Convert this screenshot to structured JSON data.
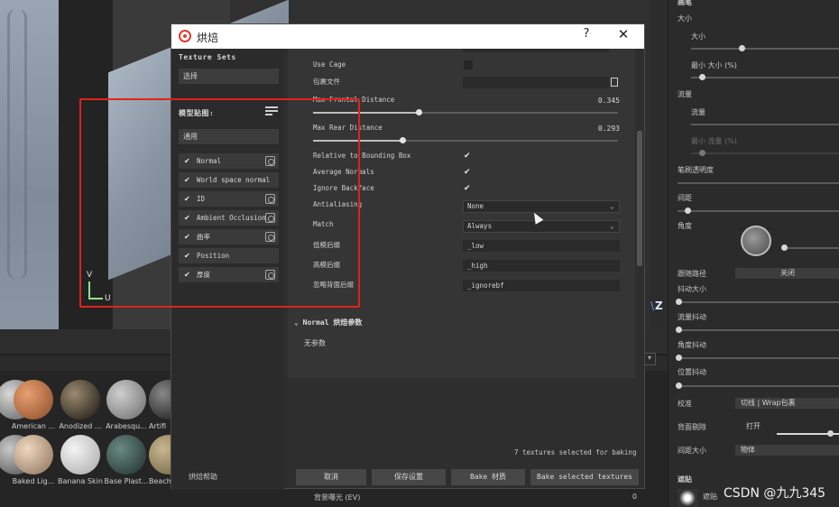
{
  "dialog": {
    "title": "烘焙",
    "help_glyph": "?",
    "close_glyph": "✕",
    "texture_sets_label": "Texture Sets",
    "texture_sets_value": "选择",
    "model_maps_label": "模型贴图:",
    "model_maps_value": "通用",
    "maps": [
      {
        "name": "Normal",
        "checked": true
      },
      {
        "name": "World space normal",
        "checked": true
      },
      {
        "name": "ID",
        "checked": true
      },
      {
        "name": "Ambient Occlusion",
        "checked": true
      },
      {
        "name": "曲率",
        "checked": true
      },
      {
        "name": "Position",
        "checked": true
      },
      {
        "name": "厚度",
        "checked": true
      }
    ],
    "settings": {
      "use_cage": "Use Cage",
      "cage_file": "包裹文件",
      "max_frontal_distance": "Max Frontal Distance",
      "max_frontal_value": "0.345",
      "max_frontal_fraction": 0.345,
      "max_rear_distance": "Max Rear Distance",
      "max_rear_value": "0.293",
      "max_rear_fraction": 0.293,
      "relative_bbox": "Relative to Bounding Box",
      "average_normals": "Average Normals",
      "ignore_backface": "Ignore Backface",
      "antialiasing": "Antialiasing",
      "antialiasing_value": "None",
      "match": "Match",
      "match_value": "Always",
      "low_suffix_label": "低模后缀",
      "low_suffix_value": "_low",
      "high_suffix_label": "高模后缀",
      "high_suffix_value": "_high",
      "ignore_backface_suffix_label": "忽略背面后缀",
      "ignore_backface_suffix_value": "_ignorebf"
    },
    "normal_section": "Normal 烘焙参数",
    "normal_none": "无参数",
    "bake_help": "烘焙帮助",
    "status": "7 textures selected for baking",
    "buttons": {
      "cancel": "取消",
      "save_settings": "保存设置",
      "bake_material": "Bake 材质",
      "bake_selected": "Bake selected textures"
    }
  },
  "viewport": {
    "axis_v": "V",
    "axis_u": "U",
    "axis_z": "Z"
  },
  "materials": {
    "row1": [
      "American ...",
      "Anodized ...",
      "Arabesqu...",
      "Artifi"
    ],
    "row2": [
      "Baked Lig...",
      "Banana Skin",
      "Base Plast...",
      "Beach"
    ]
  },
  "exposure": {
    "label": "背景曝光 (EV)",
    "value": "0"
  },
  "right_panel": {
    "header": "画笔",
    "size": "大小",
    "size_sub": "大小",
    "min_size": "最小 大小 (%)",
    "flow": "流量",
    "flow_sub": "流量",
    "min_flow": "最小 流量 (%)",
    "stroke_opacity": "笔刷透明度",
    "spacing": "间距",
    "angle": "角度",
    "follow_path": "跟随路径",
    "follow_path_value": "关闭",
    "jitter_size": "抖动大小",
    "flow_jitter": "流量抖动",
    "angle_jitter": "角度抖动",
    "position_jitter": "位置抖动",
    "alignment": "校准",
    "alignment_value": "切线 | Wrap包裹",
    "backface_cull": "背面剔除",
    "backface_cull_value": "打开",
    "spacing_size": "间距大小",
    "spacing_size_value": "物体",
    "mask": "遮贴",
    "mask_sub": "遮贴"
  },
  "watermark": "CSDN @九九345",
  "colors": {
    "highlight_box": "#e2231a",
    "dialog_bg": "#2e2e2e",
    "title_icon": "#e03b2c"
  }
}
